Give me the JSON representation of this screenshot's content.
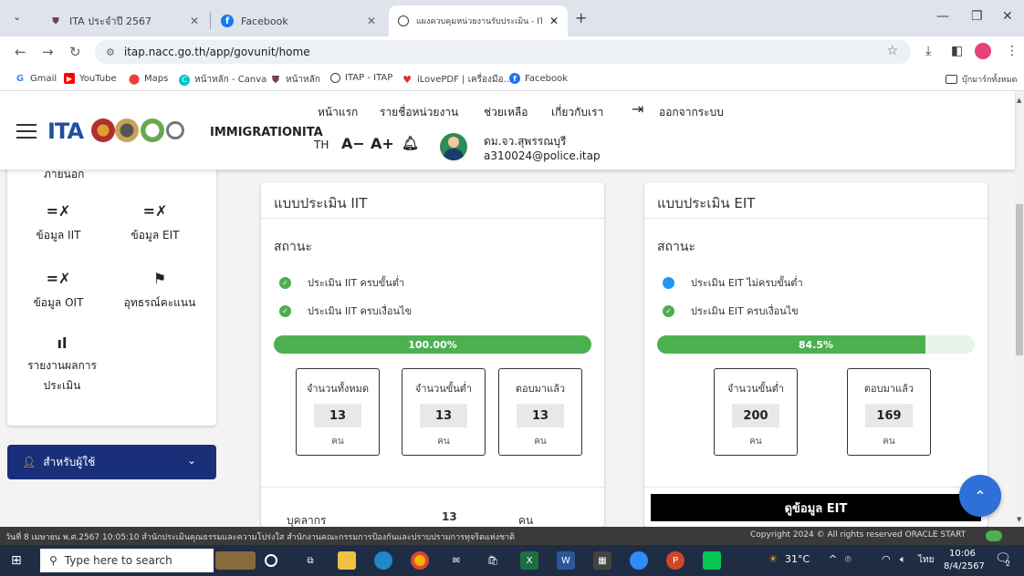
{
  "browser": {
    "tabs": [
      {
        "title": "ITA ประจำปี 2567",
        "active": false
      },
      {
        "title": "Facebook",
        "active": false
      },
      {
        "title": "แผงควบคุมหน่วยงานรับประเมิน - ITA",
        "active": true
      }
    ],
    "new_tab": "+",
    "url": "itap.nacc.go.th/app/govunit/home",
    "bookmarks": [
      "Gmail",
      "YouTube",
      "Maps",
      "หน้าหลัก - Canva",
      "หน้าหลัก",
      "ITAP - ITAP",
      "iLovePDF | เครื่องมือ...",
      "Facebook"
    ],
    "all_bookmarks": "บุ๊กมาร์กทั้งหมด"
  },
  "header": {
    "logo_text": "ITA",
    "unit_name": "IMMIGRATIONITA",
    "nav": [
      "หน้าแรก",
      "รายชื่อหน่วยงาน",
      "ช่วยเหลือ",
      "เกี่ยวกับเรา",
      "ออกจากระบบ"
    ],
    "lang": "TH",
    "font_minus": "A−",
    "font_plus": "A+",
    "user_name": "ดม.จว.สุพรรณบุรี",
    "user_email": "a310024@police.itap"
  },
  "sidebar": {
    "cut_label": "ภายนอก",
    "items": [
      {
        "label": "ข้อมูล IIT",
        "icon": "checklist-icon"
      },
      {
        "label": "ข้อมูล EIT",
        "icon": "checklist-icon"
      },
      {
        "label": "ข้อมูล OIT",
        "icon": "checklist-icon"
      },
      {
        "label": "อุทธรณ์คะแนน",
        "icon": "flag-icon"
      },
      {
        "label": "รายงานผลการประเมิน",
        "icon": "bar-chart-icon"
      }
    ],
    "user_menu": "สำหรับผู้ใช้"
  },
  "iit": {
    "title": "แบบประเมิน IIT",
    "status_heading": "สถานะ",
    "statuses": [
      {
        "text": "ประเมิน IIT ครบขั้นต่ำ",
        "state": "done"
      },
      {
        "text": "ประเมิน IIT ครบเงื่อนไข",
        "state": "done"
      }
    ],
    "progress_label": "100.00%",
    "progress_value": 100,
    "stats": [
      {
        "label": "จำนวนทั้งหมด",
        "value": "13",
        "unit": "คน"
      },
      {
        "label": "จำนวนขั้นต่ำ",
        "value": "13",
        "unit": "คน"
      },
      {
        "label": "ตอบมาแล้ว",
        "value": "13",
        "unit": "คน"
      }
    ],
    "personnel_label": "บุคลากร",
    "personnel_value": "13",
    "personnel_unit": "คน"
  },
  "eit": {
    "title": "แบบประเมิน EIT",
    "status_heading": "สถานะ",
    "statuses": [
      {
        "text": "ประเมิน EIT ไม่ครบขั้นต่ำ",
        "state": "pending"
      },
      {
        "text": "ประเมิน EIT ครบเงื่อนไข",
        "state": "done"
      }
    ],
    "progress_label": "84.5%",
    "progress_value": 84.5,
    "stats": [
      {
        "label": "จำนวนขั้นต่ำ",
        "value": "200",
        "unit": "คน"
      },
      {
        "label": "ตอบมาแล้ว",
        "value": "169",
        "unit": "คน"
      }
    ],
    "view_button": "ดูข้อมูล EIT"
  },
  "footer": {
    "left": "วันที่ 8 เมษายน พ.ศ.2567 10:05:10 สำนักประเมินคุณธรรมและความโปร่งใส สำนักงานคณะกรรมการป้องกันและปราบปรามการทุจริตแห่งชาติ",
    "right": "Copyright 2024 © All rights reserved   ORACLE   START"
  },
  "taskbar": {
    "search_placeholder": "Type here to search",
    "temperature": "31°C",
    "lang": "ไทย",
    "time": "10:06",
    "date": "8/4/2567",
    "notifications": "2"
  },
  "colors": {
    "accent_green": "#4caf50",
    "accent_blue": "#2196f3",
    "user_menu_bg": "#1a2f7a",
    "ita_blue": "#1f4fa0"
  }
}
